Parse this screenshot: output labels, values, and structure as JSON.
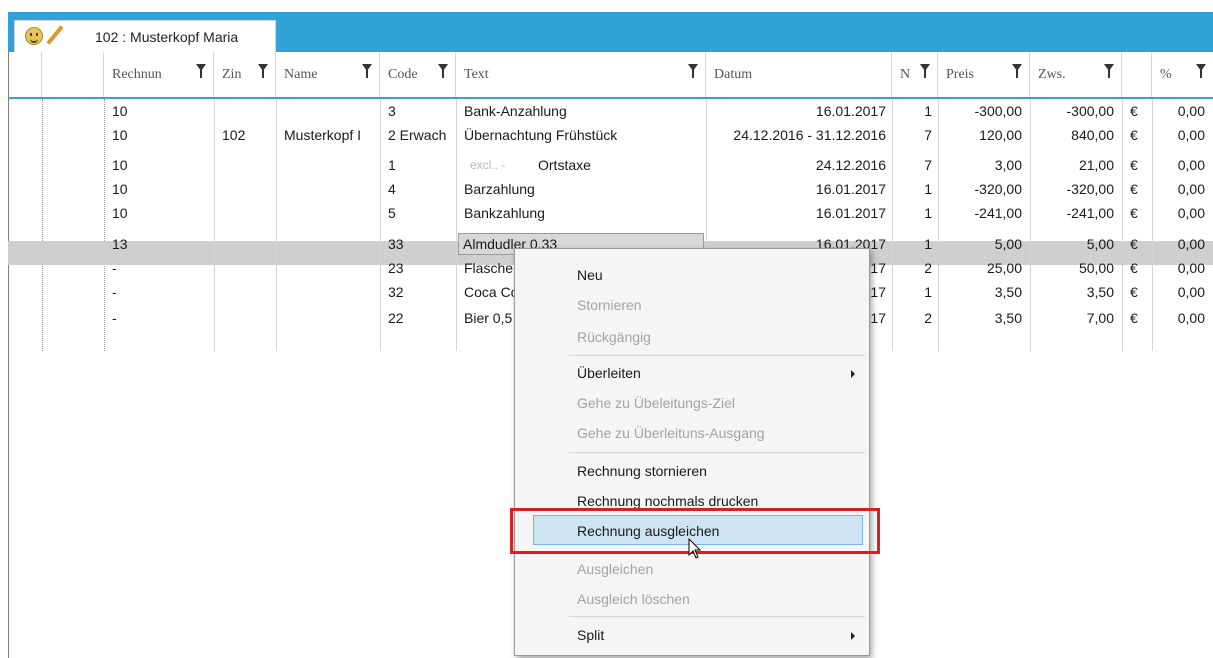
{
  "tab": {
    "title": "102 :  Musterkopf Maria"
  },
  "headers": [
    "Rechnun",
    "Zin",
    "Name",
    "Code",
    "Text",
    "Datum",
    "N",
    "Preis",
    "Zws.",
    "",
    "%"
  ],
  "rows": [
    {
      "rechnung": "10",
      "zimmer": "",
      "name": "",
      "code": "3",
      "text": "Bank-Anzahlung",
      "excl": "",
      "datum": "16.01.2017",
      "n": "1",
      "preis": "-300,00",
      "zws": "-300,00",
      "cur": "€",
      "pct": "0,00"
    },
    {
      "rechnung": "10",
      "zimmer": "102",
      "name": "Musterkopf I",
      "code": "2 Erwach",
      "text": "Übernachtung Frühstück",
      "excl": "",
      "datum": "24.12.2016 - 31.12.2016",
      "n": "7",
      "preis": "120,00",
      "zws": "840,00",
      "cur": "€",
      "pct": "0,00"
    },
    {
      "rechnung": "10",
      "zimmer": "",
      "name": "",
      "code": "1",
      "text": "Ortstaxe",
      "excl": "excl.. -",
      "datum": "24.12.2016",
      "n": "7",
      "preis": "3,00",
      "zws": "21,00",
      "cur": "€",
      "pct": "0,00"
    },
    {
      "rechnung": "10",
      "zimmer": "",
      "name": "",
      "code": "4",
      "text": "Barzahlung",
      "excl": "",
      "datum": "16.01.2017",
      "n": "1",
      "preis": "-320,00",
      "zws": "-320,00",
      "cur": "€",
      "pct": "0,00"
    },
    {
      "rechnung": "10",
      "zimmer": "",
      "name": "",
      "code": "5",
      "text": "Bankzahlung",
      "excl": "",
      "datum": "16.01.2017",
      "n": "1",
      "preis": "-241,00",
      "zws": "-241,00",
      "cur": "€",
      "pct": "0,00"
    },
    {
      "rechnung": "13",
      "zimmer": "",
      "name": "",
      "code": "33",
      "text": "Almdudler 0,33",
      "excl": "",
      "datum": "16.01.2017",
      "n": "1",
      "preis": "5,00",
      "zws": "5,00",
      "cur": "€",
      "pct": "0,00"
    },
    {
      "rechnung": "-",
      "zimmer": "",
      "name": "",
      "code": "23",
      "text": "Flasche",
      "excl": "",
      "datum": "17",
      "n": "2",
      "preis": "25,00",
      "zws": "50,00",
      "cur": "€",
      "pct": "0,00"
    },
    {
      "rechnung": "-",
      "zimmer": "",
      "name": "",
      "code": "32",
      "text": "Coca Co",
      "excl": "",
      "datum": "17",
      "n": "1",
      "preis": "3,50",
      "zws": "3,50",
      "cur": "€",
      "pct": "0,00"
    },
    {
      "rechnung": "-",
      "zimmer": "",
      "name": "",
      "code": "22",
      "text": "Bier 0,5",
      "excl": "",
      "datum": "17",
      "n": "2",
      "preis": "3,50",
      "zws": "7,00",
      "cur": "€",
      "pct": "0,00"
    }
  ],
  "menu": {
    "neu": "Neu",
    "stornieren": "Stornieren",
    "rueckgaengig": "Rückgängig",
    "ueberleiten": "Überleiten",
    "gehe_ziel": "Gehe zu Übeleitungs-Ziel",
    "gehe_ausgang": "Gehe zu Überleituns-Ausgang",
    "rechnung_stornieren": "Rechnung stornieren",
    "rechnung_drucken": "Rechnung nochmals drucken",
    "rechnung_ausgleichen": "Rechnung ausgleichen",
    "ausgleichen": "Ausgleichen",
    "ausgleich_loeschen": "Ausgleich löschen",
    "split": "Split"
  },
  "icons": {
    "tab_status": "smiley-icon",
    "tab_edit": "pencil-icon",
    "filter": "filter-icon",
    "submenu": "chevron-right-icon",
    "cursor": "mouse-pointer-icon"
  },
  "colors": {
    "header_bar": "#31a2d8",
    "selected_row": "#cfcfcf",
    "menu_highlight": "#cfe4f2",
    "annotation_box": "#d62023"
  }
}
